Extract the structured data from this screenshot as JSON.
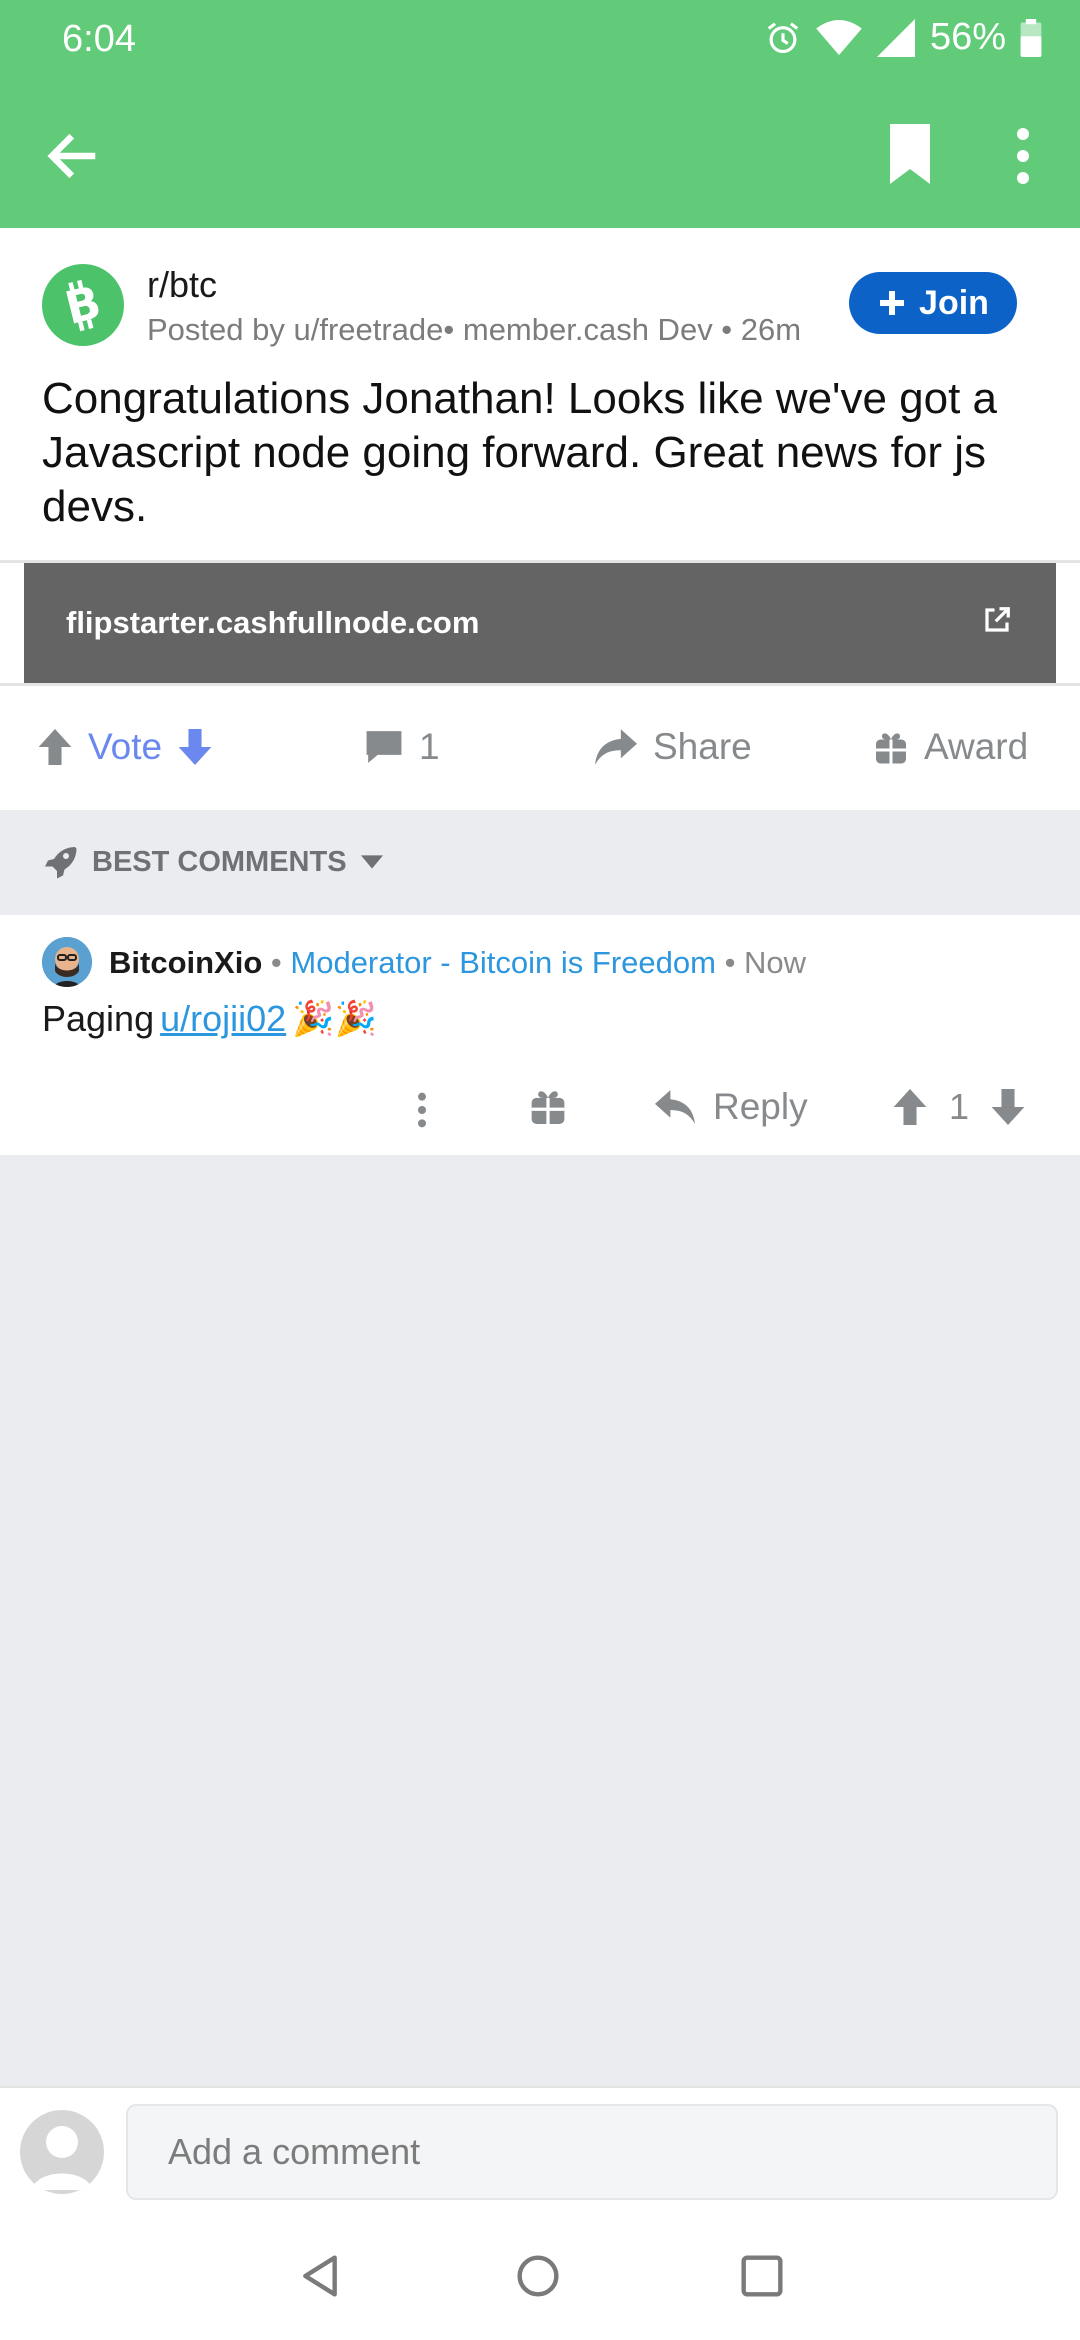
{
  "status_bar": {
    "time": "6:04",
    "battery": "56%",
    "icons": [
      "alarm-icon",
      "wifi-icon",
      "signal-icon",
      "battery-icon"
    ]
  },
  "app_bar": {
    "icons": [
      "back-arrow-icon",
      "bookmark-icon",
      "more-vert-icon"
    ],
    "accent_color": "#61cb7a"
  },
  "post": {
    "subreddit": "r/btc",
    "meta": "Posted by u/freetrade• member.cash Dev • 26m",
    "join_label": "Join",
    "title": "Congratulations Jonathan! Looks like we've got a Javascript node going forward. Great news for js devs.",
    "link_url": "flipstarter.cashfullnode.com",
    "actions": {
      "vote_label": "Vote",
      "comment_count": "1",
      "share_label": "Share",
      "award_label": "Award"
    }
  },
  "sort": {
    "label": "BEST COMMENTS"
  },
  "comment": {
    "user": "BitcoinXio",
    "sep1": "•",
    "flair": "Moderator - Bitcoin is Freedom",
    "sep2": "•",
    "time": "Now",
    "body_prefix": "Paging",
    "body_link": "u/rojii02",
    "body_emoji": "🎉🎉",
    "reply_label": "Reply",
    "score": "1"
  },
  "composer": {
    "placeholder": "Add a comment"
  },
  "colors": {
    "join_button": "#0d62c8",
    "vote_blue": "#6a88ee",
    "flair_blue": "#2c97de",
    "link_bg": "#646464"
  }
}
